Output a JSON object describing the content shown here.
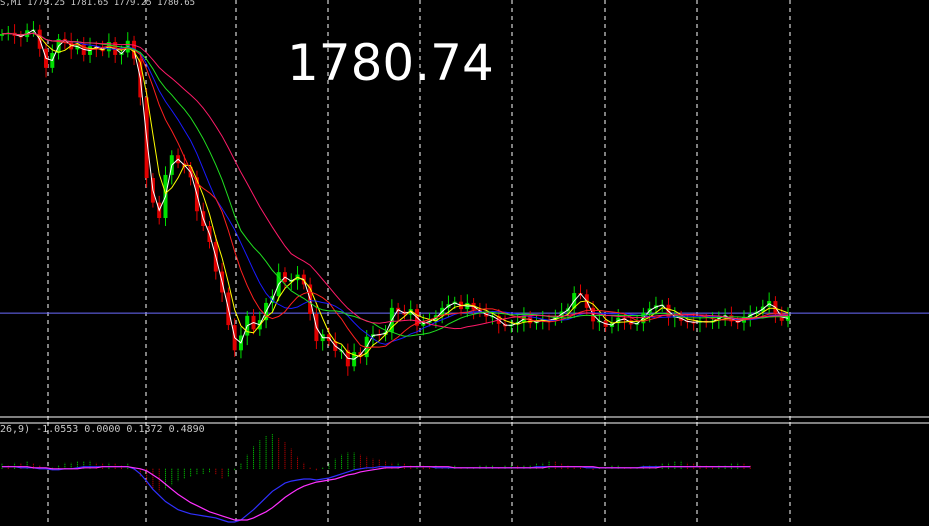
{
  "header": {
    "text": "S,M1  1779.25 1781.65 1779.25 1780.65"
  },
  "big_price": "1780.74",
  "oscillator_header": "26,9)  -1.0553 0.0000 0.1372 0.4890",
  "colors": {
    "background": "#000000",
    "bull": "#00e000",
    "bear": "#e00000",
    "grid": "#ffffff",
    "ma_white": "#ffffff",
    "ma_yellow": "#ffff00",
    "ma_blue": "#1a1aff",
    "ma_red": "#ff2020",
    "ma_green": "#20e020",
    "ma_magenta": "#ff1a6a",
    "hline": "#6b6bff",
    "macd_line": "#3030ff",
    "signal_line": "#ff30ff"
  },
  "chart_data": [
    {
      "type": "candlestick",
      "title": "",
      "current_price": 1780.74,
      "ylim": [
        1765,
        1830
      ],
      "x_count": 120,
      "close": [
        1826.1,
        1826.3,
        1825.8,
        1825.6,
        1826.7,
        1826.8,
        1823.7,
        1820.6,
        1823.0,
        1825.3,
        1824.9,
        1823.6,
        1824.5,
        1822.7,
        1824.1,
        1823.9,
        1823.3,
        1824.8,
        1822.7,
        1823.1,
        1825.0,
        1822.1,
        1815.8,
        1802.7,
        1798.7,
        1796.2,
        1803.2,
        1806.4,
        1805.1,
        1804.5,
        1802.8,
        1797.3,
        1794.9,
        1792.3,
        1787.5,
        1784.1,
        1778.8,
        1774.7,
        1777.1,
        1780.3,
        1778.1,
        1779.6,
        1782.4,
        1783.5,
        1787.4,
        1785.8,
        1786.1,
        1787.0,
        1785.4,
        1780.6,
        1776.2,
        1777.3,
        1776.2,
        1774.6,
        1774.7,
        1772.1,
        1774.4,
        1773.6,
        1776.9,
        1777.3,
        1777.2,
        1777.7,
        1781.6,
        1781.0,
        1780.5,
        1781.4,
        1778.7,
        1779.4,
        1779.4,
        1780.4,
        1781.6,
        1782.2,
        1782.6,
        1781.4,
        1782.4,
        1781.3,
        1780.9,
        1780.2,
        1780.3,
        1779.0,
        1778.6,
        1778.9,
        1779.3,
        1780.3,
        1779.1,
        1779.4,
        1779.7,
        1779.5,
        1780.2,
        1781.0,
        1781.5,
        1784.0,
        1783.8,
        1781.6,
        1779.4,
        1779.5,
        1778.5,
        1779.1,
        1780.0,
        1779.6,
        1778.9,
        1779.1,
        1780.8,
        1781.5,
        1782.0,
        1782.1,
        1780.0,
        1780.3,
        1779.5,
        1779.3,
        1779.2,
        1779.5,
        1779.2,
        1779.5,
        1780.2,
        1780.4,
        1779.4,
        1779.2,
        1780.1,
        1780.6,
        1781.0,
        1781.8,
        1782.7,
        1780.7,
        1779.5,
        1780.3
      ],
      "moving_averages": [
        "white",
        "yellow",
        "blue",
        "red",
        "green",
        "magenta"
      ]
    },
    {
      "type": "histogram",
      "title": "",
      "values": [
        0.05,
        0.04,
        0.06,
        0.05,
        0.07,
        0.05,
        0.03,
        0.02,
        0.02,
        0.04,
        0.06,
        0.06,
        0.07,
        0.07,
        0.08,
        0.06,
        0.05,
        0.06,
        0.05,
        0.04,
        0.05,
        -0.02,
        -0.08,
        -0.16,
        -0.2,
        -0.22,
        -0.2,
        -0.16,
        -0.12,
        -0.1,
        -0.08,
        -0.06,
        -0.05,
        -0.04,
        -0.06,
        -0.1,
        -0.08,
        -0.02,
        0.05,
        0.14,
        0.22,
        0.28,
        0.32,
        0.34,
        0.3,
        0.26,
        0.2,
        0.12,
        0.06,
        0.02,
        -0.02,
        0.02,
        0.06,
        0.1,
        0.14,
        0.16,
        0.16,
        0.14,
        0.12,
        0.1,
        0.09,
        0.08,
        0.06,
        0.06,
        0.05,
        0.04,
        0.04,
        0.03,
        0.02,
        0.03,
        0.02,
        0.02,
        0.03,
        0.02,
        0.02,
        0.02,
        0.03,
        0.03,
        0.03,
        0.02,
        0.03,
        0.04,
        0.03,
        0.04,
        0.04,
        0.05,
        0.06,
        0.08,
        0.07,
        0.05,
        0.03,
        0.02,
        0.01,
        0.0,
        -0.01,
        0.01,
        0.02,
        0.03,
        0.04,
        0.02,
        0.01,
        0.02,
        0.03,
        0.04,
        0.04,
        0.05,
        0.06,
        0.07,
        0.08,
        0.06,
        0.05,
        0.04,
        0.03,
        0.02,
        0.03,
        0.04,
        0.05,
        0.06,
        0.05,
        0.04
      ],
      "macd": [
        0.02,
        0.02,
        0.02,
        0.01,
        0.01,
        0.01,
        0.0,
        0.0,
        -0.01,
        -0.01,
        0.0,
        0.0,
        0.01,
        0.02,
        0.02,
        0.02,
        0.02,
        0.02,
        0.02,
        0.02,
        0.02,
        0.0,
        -0.05,
        -0.12,
        -0.2,
        -0.26,
        -0.32,
        -0.36,
        -0.4,
        -0.42,
        -0.44,
        -0.45,
        -0.46,
        -0.47,
        -0.48,
        -0.5,
        -0.52,
        -0.52,
        -0.5,
        -0.45,
        -0.4,
        -0.34,
        -0.28,
        -0.22,
        -0.18,
        -0.14,
        -0.12,
        -0.11,
        -0.1,
        -0.1,
        -0.11,
        -0.1,
        -0.09,
        -0.07,
        -0.05,
        -0.03,
        -0.01,
        0.0,
        0.01,
        0.01,
        0.02,
        0.02,
        0.02,
        0.02,
        0.02,
        0.02,
        0.02,
        0.02,
        0.02,
        0.01,
        0.01,
        0.01,
        0.01,
        0.01,
        0.01,
        0.01,
        0.01,
        0.01,
        0.01,
        0.01,
        0.01,
        0.01,
        0.01,
        0.01,
        0.01,
        0.02,
        0.02,
        0.02,
        0.02,
        0.02,
        0.02,
        0.02,
        0.02,
        0.01,
        0.01,
        0.01,
        0.01,
        0.01,
        0.01,
        0.01,
        0.01,
        0.01,
        0.02,
        0.02,
        0.02,
        0.02,
        0.02,
        0.02,
        0.02,
        0.02,
        0.02,
        0.02,
        0.02,
        0.02,
        0.02,
        0.02,
        0.02,
        0.02,
        0.02,
        0.02
      ],
      "signal": [
        0.02,
        0.02,
        0.02,
        0.02,
        0.02,
        0.01,
        0.01,
        0.01,
        0.0,
        0.0,
        0.0,
        0.0,
        0.0,
        0.01,
        0.01,
        0.01,
        0.02,
        0.02,
        0.02,
        0.02,
        0.02,
        0.01,
        0.0,
        -0.02,
        -0.06,
        -0.1,
        -0.15,
        -0.2,
        -0.25,
        -0.29,
        -0.33,
        -0.36,
        -0.39,
        -0.42,
        -0.44,
        -0.46,
        -0.48,
        -0.5,
        -0.5,
        -0.5,
        -0.48,
        -0.45,
        -0.42,
        -0.38,
        -0.33,
        -0.28,
        -0.24,
        -0.2,
        -0.17,
        -0.15,
        -0.13,
        -0.12,
        -0.11,
        -0.1,
        -0.08,
        -0.06,
        -0.05,
        -0.03,
        -0.02,
        -0.01,
        0.0,
        0.01,
        0.01,
        0.01,
        0.02,
        0.02,
        0.02,
        0.02,
        0.02,
        0.02,
        0.02,
        0.02,
        0.01,
        0.01,
        0.01,
        0.01,
        0.01,
        0.01,
        0.01,
        0.01,
        0.01,
        0.01,
        0.01,
        0.01,
        0.01,
        0.01,
        0.01,
        0.02,
        0.02,
        0.02,
        0.02,
        0.02,
        0.02,
        0.02,
        0.02,
        0.01,
        0.01,
        0.01,
        0.01,
        0.01,
        0.01,
        0.01,
        0.01,
        0.01,
        0.01,
        0.02,
        0.02,
        0.02,
        0.02,
        0.02,
        0.02,
        0.02,
        0.02,
        0.02,
        0.02,
        0.02,
        0.02,
        0.02,
        0.02,
        0.02
      ]
    }
  ]
}
